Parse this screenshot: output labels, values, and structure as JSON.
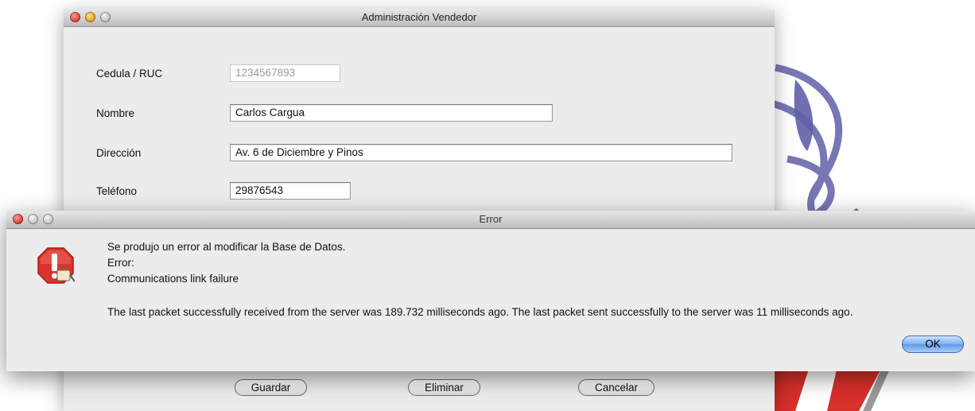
{
  "main_window": {
    "title": "Administración Vendedor",
    "fields": {
      "cedula": {
        "label": "Cedula / RUC",
        "value": "1234567893"
      },
      "nombre": {
        "label": "Nombre",
        "value": "Carlos Cargua"
      },
      "direccion": {
        "label": "Dirección",
        "value": "Av. 6 de Diciembre y Pinos"
      },
      "telefono": {
        "label": "Teléfono",
        "value": "29876543"
      }
    },
    "buttons": {
      "guardar": "Guardar",
      "eliminar": "Eliminar",
      "cancelar": "Cancelar"
    }
  },
  "error_dialog": {
    "title": "Error",
    "icon": "stop-warning-icon",
    "lines": [
      "Se produjo un error al modificar la Base de Datos.",
      "Error:",
      "Communications link failure",
      "The last packet successfully received from the server was 189.732 milliseconds ago.  The last packet sent successfully to the server was 11 milliseconds ago."
    ],
    "ok_label": "OK"
  },
  "colors": {
    "ok_button": "#6fa5ec",
    "logo_purple": "#6f6fb0",
    "logo_red": "#d8302a",
    "stop_red": "#d9332b"
  }
}
